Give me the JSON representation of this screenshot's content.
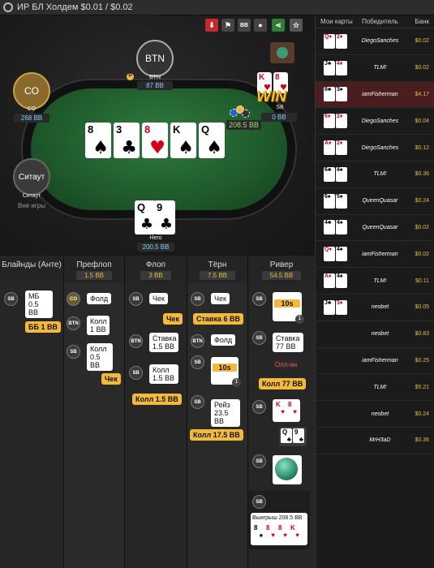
{
  "title": "ИР БЛ Холдем $0.01 / $0.02",
  "toolbar": {
    "download": "download-icon",
    "flag": "flag-icon",
    "bb": "BB",
    "spy": "spy-icon",
    "share": "share-icon",
    "star": "star-icon"
  },
  "seats": {
    "btn": {
      "label": "BTN",
      "name": "BTN",
      "stack": "87 BB"
    },
    "co": {
      "label": "CO",
      "name": "CO",
      "stack": "268 BB"
    },
    "sitout": {
      "label": "Ситаут",
      "name": "Ситаут",
      "stack": "Вне игры"
    },
    "sb": {
      "name": "SB",
      "stack": "0 BB",
      "win": "WIN"
    },
    "hero": {
      "name": "Hero",
      "stack": "200.5 BB"
    }
  },
  "board": [
    {
      "r": "8",
      "s": "♠"
    },
    {
      "r": "3",
      "s": "♣"
    },
    {
      "r": "8",
      "s": "♥"
    },
    {
      "r": "K",
      "s": "♠"
    },
    {
      "r": "Q",
      "s": "♠"
    }
  ],
  "pot": "208.5 BB",
  "hero_cards": [
    {
      "r": "Q",
      "s": "♣"
    },
    {
      "r": "9",
      "s": "♣"
    }
  ],
  "sb_cards": [
    {
      "r": "K",
      "s": "♥"
    },
    {
      "r": "8",
      "s": "♥"
    }
  ],
  "side": {
    "headers": [
      "Мои карты",
      "Победитель",
      "Банк"
    ],
    "rows": [
      {
        "c": [
          "Q♦",
          "2♦"
        ],
        "w": "DiegoSanches",
        "b": "$0.02"
      },
      {
        "c": [
          "J♣",
          "4♦"
        ],
        "w": "TLM!",
        "b": "$0.02"
      },
      {
        "c": [
          "8♣",
          "3♠"
        ],
        "w": "iamFisherman",
        "b": "$4.17"
      },
      {
        "c": [
          "6♦",
          "2♦"
        ],
        "w": "DiegoSanches",
        "b": "$0.04"
      },
      {
        "c": [
          "A♦",
          "2♦"
        ],
        "w": "DiegoSanches",
        "b": "$0.12"
      },
      {
        "c": [
          "6♣",
          "4♠"
        ],
        "w": "TLM!",
        "b": "$0.36"
      },
      {
        "c": [
          "6♠",
          "5♠"
        ],
        "w": "QueenQuasar",
        "b": "$0.24"
      },
      {
        "c": [
          "4♣",
          "4♠"
        ],
        "w": "QueenQuasar",
        "b": "$0.02"
      },
      {
        "c": [
          "Q♦",
          "4♠"
        ],
        "w": "iamFisherman",
        "b": "$0.02"
      },
      {
        "c": [
          "A♦",
          "4♠"
        ],
        "w": "TLM!",
        "b": "$0.11"
      },
      {
        "c": [
          "J♣",
          "3♦"
        ],
        "w": "neobet",
        "b": "$0.05"
      },
      {
        "c": [],
        "w": "neobet",
        "b": "$0.83"
      },
      {
        "c": [],
        "w": "iamFisherman",
        "b": "$0.25"
      },
      {
        "c": [],
        "w": "TLM!",
        "b": "$5.21"
      },
      {
        "c": [],
        "w": "neobet",
        "b": "$0.24"
      },
      {
        "c": [],
        "w": "MrH3aD",
        "b": "$0.36"
      }
    ]
  },
  "streets": [
    {
      "name": "Блайнды (Анте)",
      "pot": ""
    },
    {
      "name": "Префлоп",
      "pot": "1.5 BB"
    },
    {
      "name": "Флоп",
      "pot": "3 BB"
    },
    {
      "name": "Тёрн",
      "pot": "7.5 BB"
    },
    {
      "name": "Ривер",
      "pot": "54.5 BB"
    }
  ],
  "acts": {
    "sb_blind": "МБ 0.5 BB",
    "bb_blind": "ББ 1 BB",
    "co_fold": "Фолд",
    "btn_call": "Колл 1 BB",
    "sb_call": "Колл 0.5 BB",
    "check_y": "Чек",
    "sb_check": "Чек",
    "check2_y": "Чек",
    "btn_bet": "Ставка 1.5 BB",
    "sb_call2": "Колл 1.5 BB",
    "call_y": "Колл 1.5 BB",
    "sb_check3": "Чек",
    "bet_y": "Ставка 6 BB",
    "btn_fold": "Фолд",
    "timer": "10s",
    "timer_n": "1",
    "sb_raise": "Рейз 23.5 BB",
    "call17_y": "Колл 17.5 BB",
    "timer2": "10s",
    "timer2_n": "1",
    "sb_bet": "Ставка 77 BB",
    "allin": "Олл-ин",
    "call77_y": "Колл 77 BB",
    "win": "Выигрыш 208.5 BB",
    "sb": "SB",
    "btn": "BTN",
    "co": "CO"
  },
  "colors": {
    "accent": "#f2b93b",
    "felt": "#1f5a2c"
  }
}
